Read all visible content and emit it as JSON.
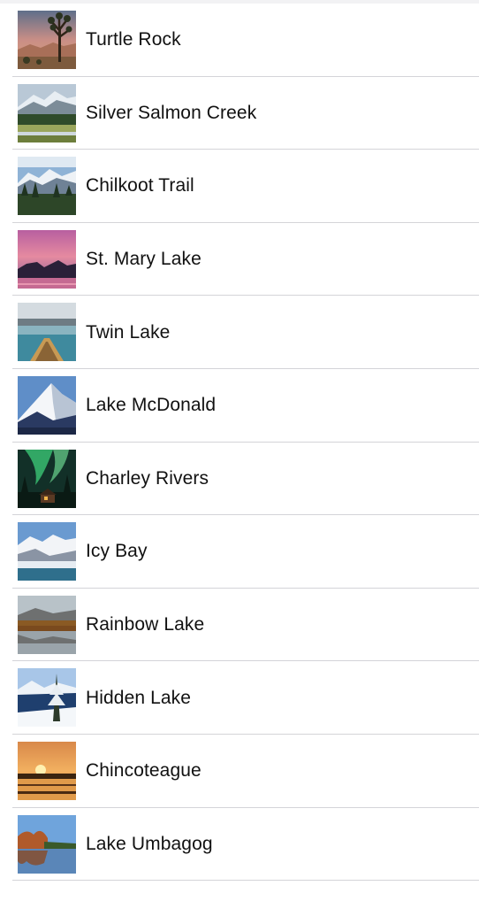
{
  "landmarks": [
    {
      "name": "Turtle Rock",
      "image": "joshua-tree-desert-photo"
    },
    {
      "name": "Silver Salmon Creek",
      "image": "mountain-meadow-photo"
    },
    {
      "name": "Chilkoot Trail",
      "image": "snowy-mountain-forest-photo"
    },
    {
      "name": "St. Mary Lake",
      "image": "sunset-lake-photo"
    },
    {
      "name": "Twin Lake",
      "image": "kayak-lake-photo"
    },
    {
      "name": "Lake McDonald",
      "image": "snow-peak-photo"
    },
    {
      "name": "Charley Rivers",
      "image": "aurora-cabin-photo"
    },
    {
      "name": "Icy Bay",
      "image": "glacier-bay-photo"
    },
    {
      "name": "Rainbow Lake",
      "image": "reflection-lake-photo"
    },
    {
      "name": "Hidden Lake",
      "image": "winter-lake-photo"
    },
    {
      "name": "Chincoteague",
      "image": "sunset-marsh-photo"
    },
    {
      "name": "Lake Umbagog",
      "image": "autumn-lake-photo"
    }
  ]
}
